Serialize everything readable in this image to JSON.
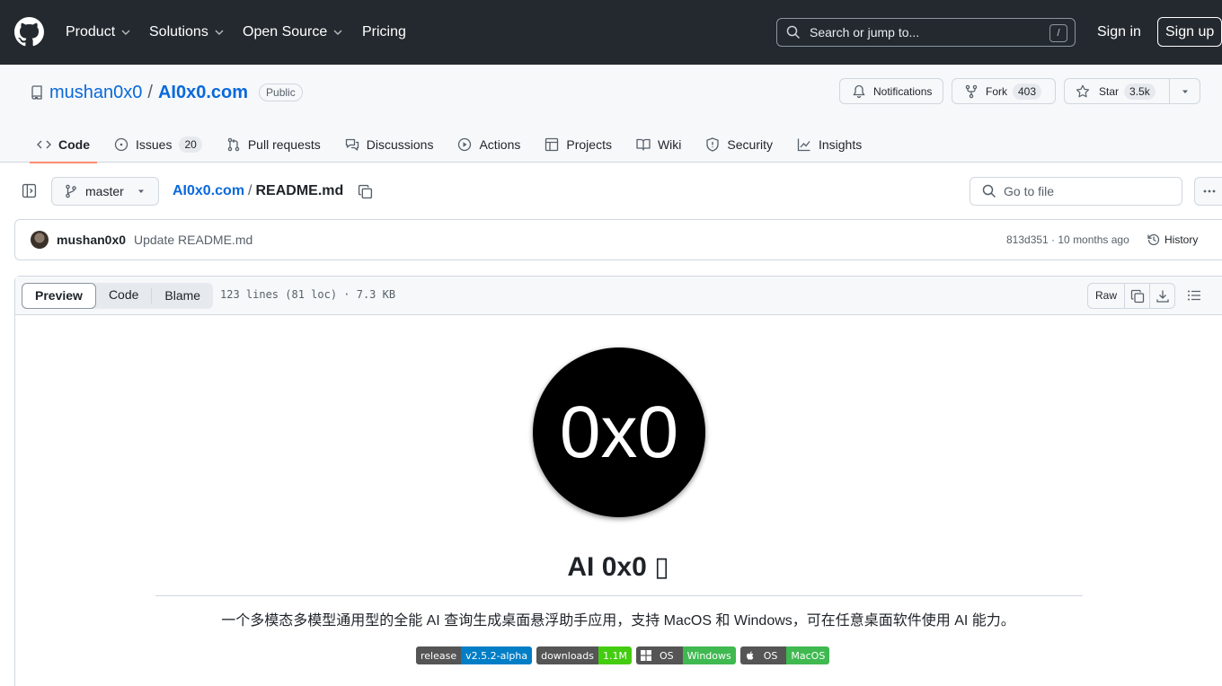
{
  "header": {
    "nav": [
      {
        "label": "Product"
      },
      {
        "label": "Solutions"
      },
      {
        "label": "Open Source"
      },
      {
        "label": "Pricing"
      }
    ],
    "search_placeholder": "Search or jump to...",
    "search_shortcut": "/",
    "sign_in": "Sign in",
    "sign_up": "Sign up"
  },
  "repo": {
    "owner": "mushan0x0",
    "name": "AI0x0.com",
    "visibility": "Public",
    "notifications_label": "Notifications",
    "fork_label": "Fork",
    "fork_count": "403",
    "star_label": "Star",
    "star_count": "3.5k"
  },
  "tabs": [
    {
      "label": "Code",
      "icon": "code-icon",
      "active": true
    },
    {
      "label": "Issues",
      "icon": "issue-icon",
      "count": "20"
    },
    {
      "label": "Pull requests",
      "icon": "pull-request-icon"
    },
    {
      "label": "Discussions",
      "icon": "comment-discussion-icon"
    },
    {
      "label": "Actions",
      "icon": "play-icon"
    },
    {
      "label": "Projects",
      "icon": "table-icon"
    },
    {
      "label": "Wiki",
      "icon": "book-icon"
    },
    {
      "label": "Security",
      "icon": "shield-icon"
    },
    {
      "label": "Insights",
      "icon": "graph-icon"
    }
  ],
  "file": {
    "branch": "master",
    "repo_crumb": "AI0x0.com",
    "separator": "/",
    "filename": "README.md",
    "goto_placeholder": "Go to file",
    "commit_author": "mushan0x0",
    "commit_message": "Update README.md",
    "commit_meta": "813d351 · 10 months ago",
    "history_label": "History",
    "view_tabs": [
      "Preview",
      "Code",
      "Blame"
    ],
    "stats": "123 lines (81 loc) · 7.3 KB",
    "raw_label": "Raw"
  },
  "readme": {
    "logo_text": "0x0",
    "title": "AI 0x0 ",
    "title_glyph": "▯",
    "description": "一个多模态多模型通用型的全能 AI 查询生成桌面悬浮助手应用，支持 MacOS 和 Windows，可在任意桌面软件使用 AI 能力。",
    "badges": [
      {
        "label": "release",
        "value": "v2.5.2-alpha",
        "color": "#007ec6",
        "icon": ""
      },
      {
        "label": "downloads",
        "value": "1.1M",
        "color": "#4c1",
        "icon": ""
      },
      {
        "label": "OS",
        "value": "Windows",
        "color": "#3fb950",
        "icon": "windows-icon"
      },
      {
        "label": "OS",
        "value": "MacOS",
        "color": "#3fb950",
        "icon": "apple-icon"
      }
    ]
  },
  "colors": {
    "header_bg": "#24292f",
    "link": "#0969da",
    "active_tab_underline": "#fd8c73"
  }
}
